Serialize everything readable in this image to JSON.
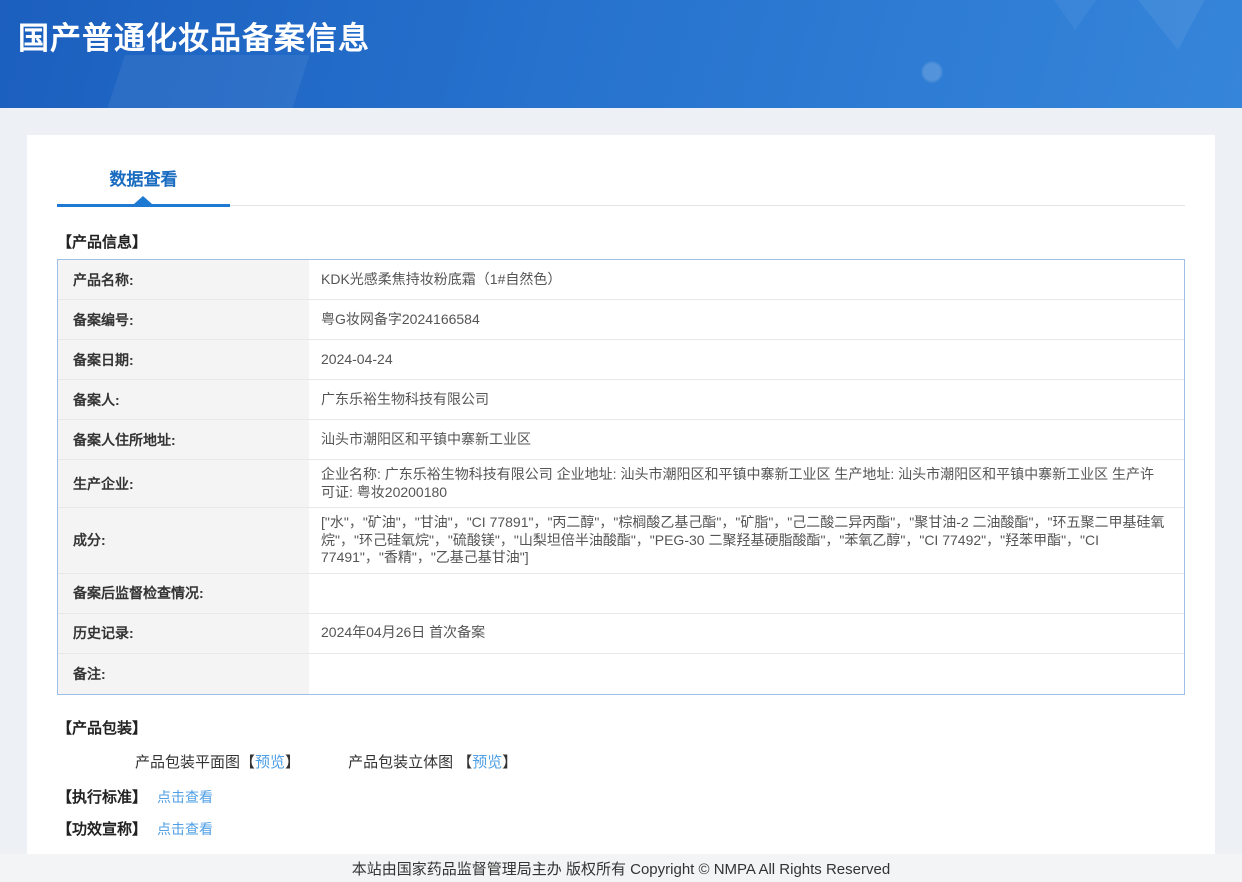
{
  "header": {
    "title": "国产普通化妆品备案信息"
  },
  "tabs": {
    "data_view": "数据查看"
  },
  "sections": {
    "product_info": "【产品信息】",
    "packaging": "【产品包装】",
    "standard": "【执行标准】",
    "efficacy": "【功效宣称】"
  },
  "table": {
    "rows": [
      {
        "label": "产品名称:",
        "value": "KDK光感柔焦持妆粉底霜（1#自然色）"
      },
      {
        "label": "备案编号:",
        "value": "粤G妆网备字2024166584"
      },
      {
        "label": "备案日期:",
        "value": "2024-04-24"
      },
      {
        "label": "备案人:",
        "value": "广东乐裕生物科技有限公司"
      },
      {
        "label": "备案人住所地址:",
        "value": "汕头市潮阳区和平镇中寨新工业区"
      },
      {
        "label": "生产企业:",
        "value": "企业名称: 广东乐裕生物科技有限公司 企业地址: 汕头市潮阳区和平镇中寨新工业区 生产地址: 汕头市潮阳区和平镇中寨新工业区 生产许可证: 粤妆20200180"
      },
      {
        "label": "成分:",
        "value": "[\"水\"，\"矿油\"，\"甘油\"，\"CI 77891\"，\"丙二醇\"，\"棕榈酸乙基己酯\"，\"矿脂\"，\"己二酸二异丙酯\"，\"聚甘油-2 二油酸酯\"，\"环五聚二甲基硅氧烷\"，\"环己硅氧烷\"，\"硫酸镁\"，\"山梨坦倍半油酸酯\"，\"PEG-30 二聚羟基硬脂酸酯\"，\"苯氧乙醇\"，\"CI 77492\"，\"羟苯甲酯\"，\"CI 77491\"，\"香精\"，\"乙基己基甘油\"]"
      },
      {
        "label": "备案后监督检查情况:",
        "value": ""
      },
      {
        "label": "历史记录:",
        "value": "2024年04月26日 首次备案"
      },
      {
        "label": "备注:",
        "value": ""
      }
    ]
  },
  "packaging": {
    "flat_label": "产品包装平面图",
    "stereo_label": "产品包装立体图 ",
    "bracket_open": "【",
    "bracket_close": "】",
    "preview": "预览"
  },
  "links": {
    "click_to_view": "点击查看"
  },
  "footer": {
    "text": "本站由国家药品监督管理局主办 版权所有 Copyright © NMPA All Rights Reserved"
  },
  "colors": {
    "accent": "#1a6cc0",
    "tab_underline": "#1e79d2",
    "link": "#4e9fe5",
    "header_gradient_start": "#1c5fbe",
    "header_gradient_end": "#3585da",
    "table_border": "#9fc0e6",
    "label_bg": "#f4f4f4"
  }
}
